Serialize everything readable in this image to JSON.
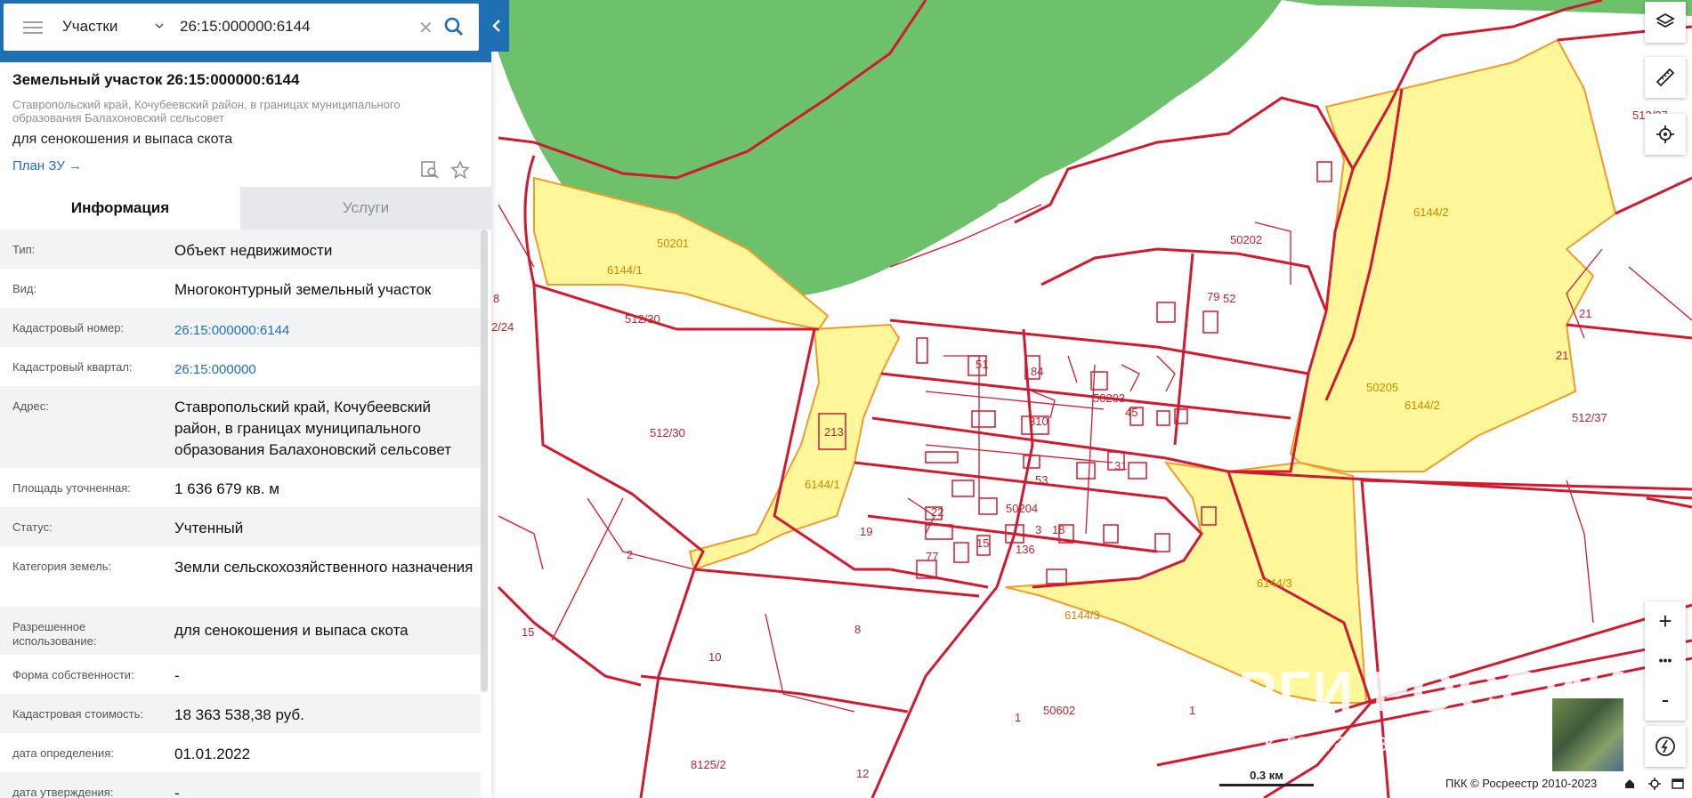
{
  "search": {
    "category": "Участки",
    "query": "26:15:000000:6144"
  },
  "parcel": {
    "title": "Земельный участок 26:15:000000:6144",
    "address_short": "Ставропольский край, Кочубеевский район, в границах муниципального образования Балахоновский сельсовет",
    "purpose": "для сенокошения и выпаса скота",
    "plan_link": "План ЗУ →"
  },
  "tabs": [
    {
      "label": "Информация",
      "active": true
    },
    {
      "label": "Услуги",
      "active": false
    }
  ],
  "info_rows": [
    {
      "label": "Тип:",
      "value": "Объект недвижимости",
      "link": false
    },
    {
      "label": "Вид:",
      "value": "Многоконтурный земельный участок",
      "link": false
    },
    {
      "label": "Кадастровый номер:",
      "value": "26:15:000000:6144",
      "link": true
    },
    {
      "label": "Кадастровый квартал:",
      "value": "26:15:000000",
      "link": true
    },
    {
      "label": "Адрес:",
      "value": "Ставропольский край, Кочубеевский район, в границах муниципального образования Балахоновский сельсовет",
      "link": false
    },
    {
      "label": "Площадь уточненная:",
      "value": "1 636 679 кв. м",
      "link": false
    },
    {
      "label": "Статус:",
      "value": "Учтенный",
      "link": false
    },
    {
      "label": "Категория земель:",
      "value": "Земли сельскохозяйственного назначения",
      "link": false
    },
    {
      "label": "Разрешенное использование:",
      "value": "для сенокошения и выпаса скота",
      "link": false
    },
    {
      "label": "Форма собственности:",
      "value": "-",
      "link": false
    },
    {
      "label": "Кадастровая стоимость:",
      "value": "18 363 538,38 руб.",
      "link": false
    },
    {
      "label": "дата определения:",
      "value": "01.01.2022",
      "link": false
    },
    {
      "label": "дата утверждения:",
      "value": "-",
      "link": false
    }
  ],
  "map_labels": {
    "l50201": "50201",
    "l6144_1a": "6144/1",
    "l512_30a": "512/30",
    "l512_30b": "512/30",
    "l2_24": "2/24",
    "l50202": "50202",
    "l6144_2a": "6144/2",
    "l6144_2b": "6144/2",
    "l50205": "50205",
    "l21a": "21",
    "l21b": "21",
    "l512_37": "512/37",
    "l512_27": "512/27",
    "l50203": "50203",
    "l50204": "50204",
    "l213": "213",
    "l6144_1b": "6144/1",
    "l310": "310",
    "l53": "53",
    "l84": "84",
    "l45": "45",
    "l31": "31",
    "l79": "79",
    "l52": "52",
    "l51": "51",
    "l22": "22",
    "l19": "19",
    "l77": "77",
    "l15a": "15",
    "l136": "136",
    "l3": "3",
    "l18": "18",
    "l6144_3a": "6144/3",
    "l6144_3b": "6144/3",
    "l2": "2",
    "l15b": "15",
    "l10": "10",
    "l8": "8",
    "l1a": "1",
    "l1b": "1",
    "l50602": "50602",
    "l8125_2": "8125/2",
    "l12": "12",
    "l8a": "8"
  },
  "map": {
    "scale": "0.3 км",
    "copyright": "ПКК © Росреестр 2010-2023",
    "watermark_1": "ТОРГИ РОССИИ",
    "watermark_2": "к торгам в",
    "colors": {
      "boundary": "#d11a2f",
      "selected_fill": "#fff79a",
      "selected_stroke": "#f29a2e",
      "water": "#6cc16a",
      "accent": "#1f6fb3"
    }
  },
  "controls": {
    "zoom_in": "+",
    "more": "•••",
    "zoom_out": "-"
  }
}
